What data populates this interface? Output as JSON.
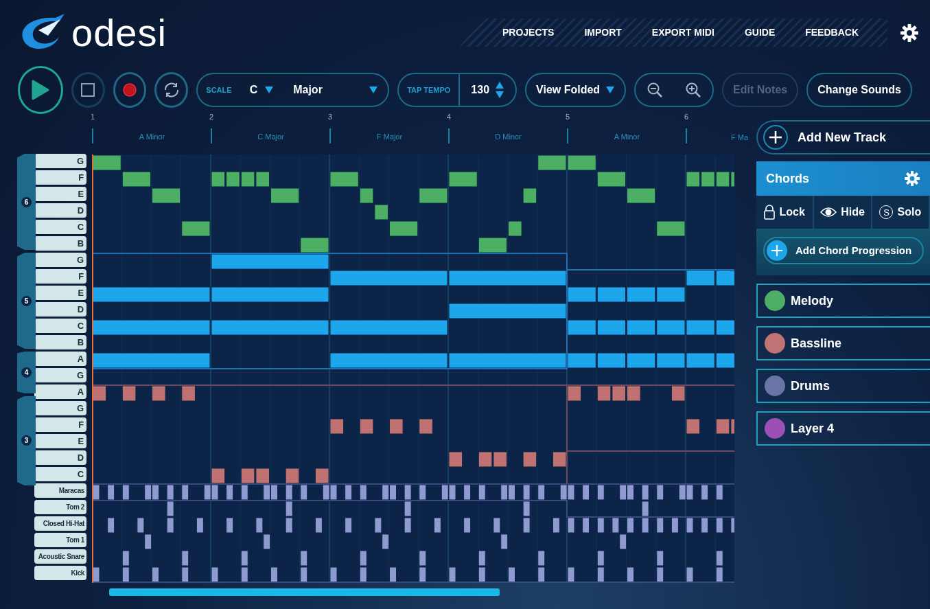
{
  "app": {
    "brand": "odesi"
  },
  "nav": [
    {
      "label": "PROJECTS"
    },
    {
      "label": "IMPORT"
    },
    {
      "label": "EXPORT MIDI"
    },
    {
      "label": "GUIDE"
    },
    {
      "label": "FEEDBACK"
    }
  ],
  "transport": [
    {
      "kind": "play"
    },
    {
      "kind": "stop"
    },
    {
      "kind": "record"
    },
    {
      "kind": "loop"
    }
  ],
  "scale": {
    "label": "SCALE",
    "key": "C",
    "mode": "Major"
  },
  "tempo": {
    "label": "TAP TEMPO",
    "value": "130"
  },
  "view": {
    "value": "View Folded"
  },
  "buttons": [
    {
      "label": "Edit Notes",
      "disabled": true
    },
    {
      "label": "Change Sounds",
      "disabled": false
    }
  ],
  "ruler": {
    "bars": [
      "1",
      "2",
      "3",
      "4",
      "5",
      "6"
    ],
    "chords": [
      "A Minor",
      "C Major",
      "F Major",
      "D Minor",
      "A Minor",
      "F Ma"
    ]
  },
  "octaves": [
    "6",
    "5",
    "4",
    "3"
  ],
  "keys": [
    "G",
    "F",
    "E",
    "D",
    "C",
    "B",
    "G",
    "F",
    "E",
    "D",
    "C",
    "B",
    "A",
    "G",
    "A",
    "G",
    "F",
    "E",
    "D",
    "C",
    "Maracas",
    "Tom 2",
    "Closed Hi-Hat",
    "Tom 1",
    "Acoustic Snare",
    "Kick"
  ],
  "add_track": "Add New Track",
  "tracks": [
    {
      "name": "Chords",
      "selected": true,
      "actions": [
        {
          "kind": "lock",
          "label": "Lock"
        },
        {
          "kind": "hide",
          "label": "Hide"
        },
        {
          "kind": "solo",
          "label": "Solo",
          "badge": "S"
        }
      ],
      "add_label": "Add Chord Progression"
    },
    {
      "name": "Melody",
      "selected": false,
      "color": "#4fae66"
    },
    {
      "name": "Bassline",
      "selected": false,
      "color": "#bf7374"
    },
    {
      "name": "Drums",
      "selected": false,
      "color": "#6a74a6"
    },
    {
      "name": "Layer 4",
      "selected": false,
      "color": "#9b50b6"
    }
  ]
}
